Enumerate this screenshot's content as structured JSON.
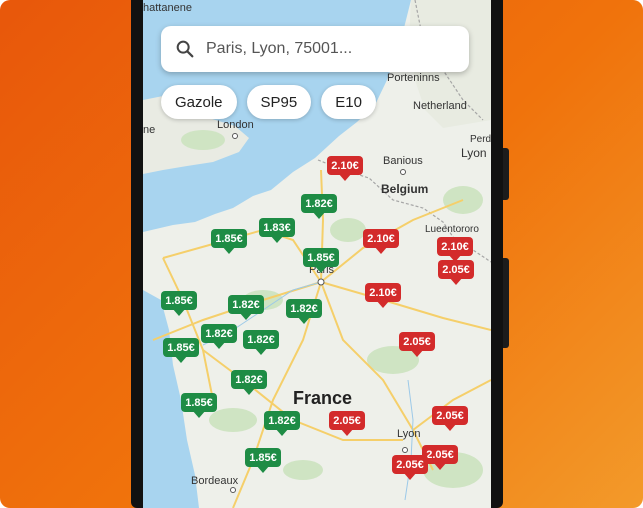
{
  "search": {
    "placeholder": "Paris, Lyon, 75001..."
  },
  "fuel_chips": [
    "Gazole",
    "SP95",
    "E10"
  ],
  "map_labels": {
    "hattanene": "hattanene",
    "porteninns": "Porteninns",
    "netherland": "Netherland",
    "london": "London",
    "ne": "ne",
    "perd": "Perd",
    "lyon_ne": "Lyon",
    "banious": "Banious",
    "belgium": "Belgium",
    "lueentororo": "Lueentororo",
    "paris": "Paris",
    "france": "France",
    "lyon": "Lyon",
    "bordeaux": "Bordeaux"
  },
  "price_markers": [
    {
      "price": "2.10€",
      "status": "expensive"
    },
    {
      "price": "1.82€",
      "status": "cheap"
    },
    {
      "price": "1.83€",
      "status": "cheap"
    },
    {
      "price": "1.85€",
      "status": "cheap"
    },
    {
      "price": "2.10€",
      "status": "expensive"
    },
    {
      "price": "2.10€",
      "status": "expensive"
    },
    {
      "price": "2.05€",
      "status": "expensive"
    },
    {
      "price": "1.85€",
      "status": "cheap"
    },
    {
      "price": "2.10€",
      "status": "expensive"
    },
    {
      "price": "1.85€",
      "status": "cheap"
    },
    {
      "price": "1.82€",
      "status": "cheap"
    },
    {
      "price": "1.82€",
      "status": "cheap"
    },
    {
      "price": "1.82€",
      "status": "cheap"
    },
    {
      "price": "1.82€",
      "status": "cheap"
    },
    {
      "price": "1.85€",
      "status": "cheap"
    },
    {
      "price": "2.05€",
      "status": "expensive"
    },
    {
      "price": "1.82€",
      "status": "cheap"
    },
    {
      "price": "1.85€",
      "status": "cheap"
    },
    {
      "price": "1.82€",
      "status": "cheap"
    },
    {
      "price": "2.05€",
      "status": "expensive"
    },
    {
      "price": "2.05€",
      "status": "expensive"
    },
    {
      "price": "1.85€",
      "status": "cheap"
    },
    {
      "price": "2.05€",
      "status": "expensive"
    },
    {
      "price": "2.05€",
      "status": "expensive"
    }
  ],
  "colors": {
    "background_gradient": [
      "#e8570b",
      "#f39a2a"
    ],
    "cheap_marker": "#1e8c45",
    "expensive_marker": "#d32b2b",
    "sea": "#a8d4ef",
    "land": "#eef0ea"
  }
}
